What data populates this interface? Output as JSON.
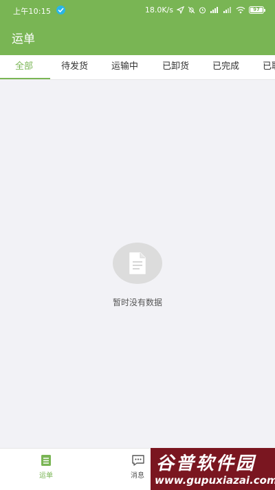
{
  "status_bar": {
    "time": "上午10:15",
    "network_speed": "18.0K/s",
    "battery_level": "97"
  },
  "header": {
    "title": "运单",
    "background_color": "#79b554"
  },
  "tabs": [
    {
      "label": "全部",
      "active": true
    },
    {
      "label": "待发货",
      "active": false
    },
    {
      "label": "运输中",
      "active": false
    },
    {
      "label": "已卸货",
      "active": false
    },
    {
      "label": "已完成",
      "active": false
    },
    {
      "label": "已取",
      "active": false
    }
  ],
  "empty_state": {
    "icon": "document-icon",
    "message": "暂时没有数据"
  },
  "bottom_nav": {
    "items": [
      {
        "label": "运单",
        "icon": "waybill-icon",
        "active": true
      },
      {
        "label": "消息",
        "icon": "message-icon",
        "active": false
      }
    ]
  },
  "watermark": {
    "title": "谷普软件园",
    "url": "www.gupuxiazai.com"
  },
  "colors": {
    "accent": "#79b554",
    "background": "#f2f2f6"
  }
}
